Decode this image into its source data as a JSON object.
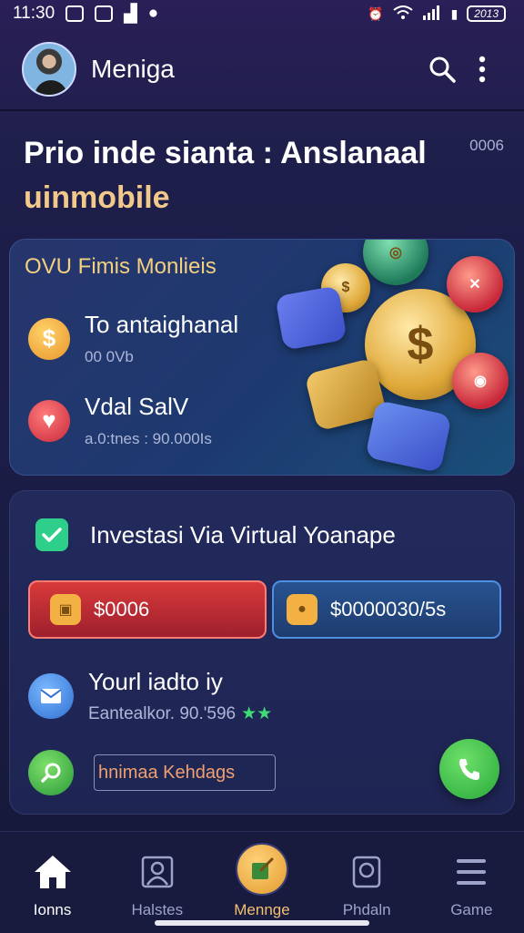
{
  "status_bar": {
    "time": "11:30",
    "battery_text": "2013"
  },
  "app_bar": {
    "title": "Meniga",
    "avatar_icon": "user-avatar",
    "search_icon": "search-icon",
    "menu_icon": "more-vert-icon"
  },
  "hero": {
    "title": "Prio inde sianta : Anslanaal",
    "subtitle": "uinmobile",
    "badge": "0006"
  },
  "card1": {
    "title": "OVU Fimis Monlieis",
    "items": [
      {
        "icon": "dollar-icon",
        "main": "To antaighanal",
        "sub": "00 0Vb"
      },
      {
        "icon": "heart-icon",
        "main": "Vdal SalV",
        "sub": "a.0:tnes : 90.000Is"
      }
    ]
  },
  "card2": {
    "title": "Investasi Via Virtual Yoanape",
    "btn_red_label": "$0006",
    "btn_blue_label": "$0000030/5s",
    "row_title": "Yourl iadto iy",
    "row_sub": "Eantealkor. 90.'596",
    "row_stars": "★★",
    "hint_text": "hnimaa Kehdags"
  },
  "colors": {
    "accent_gold": "#f3cf80",
    "green": "#2ecf8a",
    "red": "#d83a3a",
    "blue": "#27538f"
  },
  "bottom_nav": [
    {
      "label": "Ionns",
      "icon": "home-icon"
    },
    {
      "label": "Halstes",
      "icon": "profile-icon"
    },
    {
      "label": "Mennge",
      "icon": "manage-icon"
    },
    {
      "label": "Phdaln",
      "icon": "device-icon"
    },
    {
      "label": "Game",
      "icon": "menu-icon"
    }
  ]
}
